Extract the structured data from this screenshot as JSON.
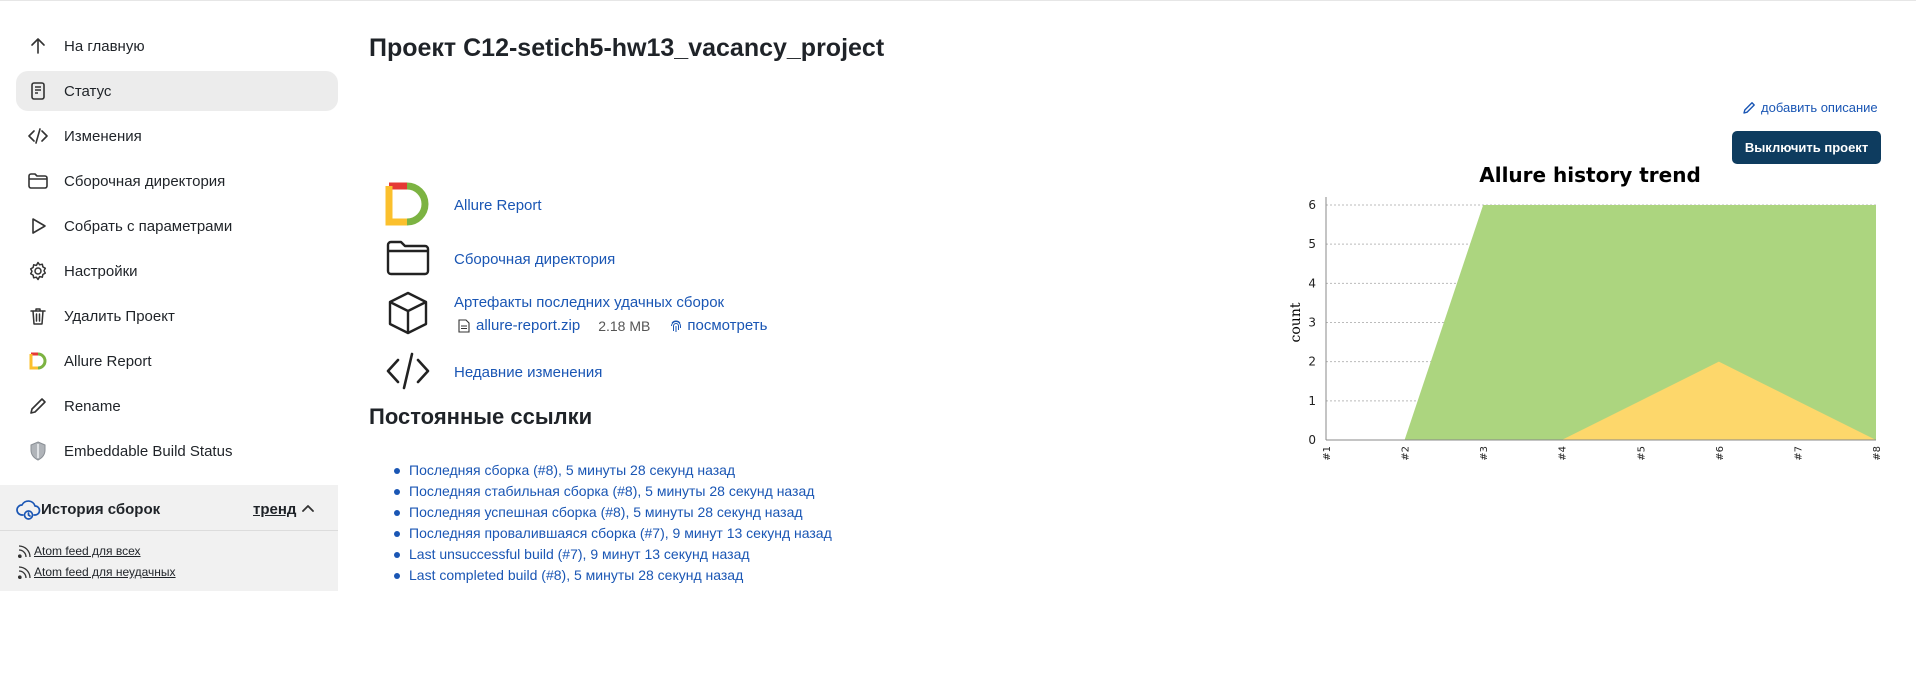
{
  "sidebar": {
    "items": [
      {
        "label": "На главную",
        "icon": "arrow-up-icon"
      },
      {
        "label": "Статус",
        "icon": "document-icon"
      },
      {
        "label": "Изменения",
        "icon": "code-icon"
      },
      {
        "label": "Сборочная директория",
        "icon": "folder-icon"
      },
      {
        "label": "Собрать с параметрами",
        "icon": "play-icon"
      },
      {
        "label": "Настройки",
        "icon": "gear-icon"
      },
      {
        "label": "Удалить Проект",
        "icon": "trash-icon"
      },
      {
        "label": "Allure Report",
        "icon": "allure-logo-icon"
      },
      {
        "label": "Rename",
        "icon": "pencil-icon"
      },
      {
        "label": "Embeddable Build Status",
        "icon": "shield-icon"
      }
    ],
    "active_index": 1
  },
  "history": {
    "title": "История сборок",
    "trend_label": "тренд",
    "feeds": [
      "Atom feed для всех",
      "Atom feed для неудачных"
    ]
  },
  "main": {
    "title": "Проект C12-setich5-hw13_vacancy_project",
    "add_description": "добавить описание",
    "disable_button": "Выключить проект",
    "artifacts": {
      "allure_report": "Allure Report",
      "workspace": "Сборочная директория",
      "last_artifacts": "Артефакты последних удачных сборок",
      "zip_name": "allure-report.zip",
      "zip_size": "2.18 MB",
      "view": "посмотреть",
      "recent_changes": "Недавние изменения"
    },
    "permalinks_title": "Постоянные ссылки",
    "permalinks": [
      "Последняя сборка (#8), 5 минуты 28 секунд назад",
      "Последняя стабильная сборка (#8), 5 минуты 28 секунд назад",
      "Последняя успешная сборка (#8), 5 минуты 28 секунд назад",
      "Последняя провалившаяся сборка (#7), 9 минут 13 секунд назад",
      "Last unsuccessful build (#7), 9 минут 13 секунд назад",
      "Last completed build (#8), 5 минуты 28 секунд назад"
    ]
  },
  "colors": {
    "accent_link": "#1a56b4",
    "button_bg": "#0e3c5f",
    "passed_area": "#acd57f",
    "failed_area": "#fdd76b"
  },
  "chart_data": {
    "type": "area",
    "title": "Allure history trend",
    "ylabel": "count",
    "xlabel": "",
    "categories": [
      "#1",
      "#2",
      "#3",
      "#4",
      "#5",
      "#6",
      "#7",
      "#8"
    ],
    "ylim": [
      0,
      6
    ],
    "yticks": [
      "0",
      "1",
      "2",
      "3",
      "4",
      "5",
      "6"
    ],
    "grid": true,
    "series": [
      {
        "values": [
          null,
          0,
          6,
          6,
          6,
          6,
          6,
          6
        ],
        "color": "#acd57f"
      },
      {
        "values": [
          null,
          null,
          null,
          0,
          1,
          2,
          1,
          0
        ],
        "color": "#fdd76b"
      }
    ]
  }
}
